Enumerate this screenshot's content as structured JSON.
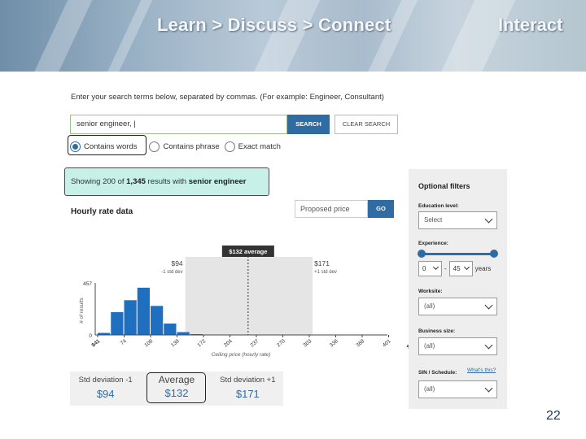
{
  "banner": {
    "title": "Learn > Discuss > Connect",
    "right": "Interact"
  },
  "search": {
    "instructions": "Enter your search terms below, separated by commas. (For example: Engineer, Consultant)",
    "value": "senior engineer, |",
    "search_label": "SEARCH",
    "clear_label": "CLEAR SEARCH",
    "options": [
      "Contains words",
      "Contains phrase",
      "Exact match"
    ],
    "selected_option": "Contains words"
  },
  "results": {
    "prefix": "Showing 200 of ",
    "count": "1,345",
    "middle": " results with ",
    "term": "senior engineer"
  },
  "hourly": {
    "title": "Hourly rate data"
  },
  "price": {
    "placeholder": "Proposed price",
    "go_label": "GO"
  },
  "chart_data": {
    "type": "bar",
    "ylabel": "# of results",
    "xlabel": "Ceiling price (hourly rate)",
    "ylim": [
      0,
      457
    ],
    "y_ticks": [
      "457",
      "0"
    ],
    "x_ticks": [
      "$41",
      "74",
      "106",
      "139",
      "172",
      "204",
      "237",
      "270",
      "303",
      "336",
      "368",
      "401",
      "$434"
    ],
    "bins": [
      41,
      57,
      74,
      90,
      106,
      123,
      139,
      155,
      172,
      188,
      204,
      221,
      237
    ],
    "values": [
      18,
      200,
      305,
      415,
      255,
      100,
      25,
      7,
      0,
      0,
      0,
      0,
      0
    ],
    "average": {
      "label": "$132 average",
      "value": 132
    },
    "std_low": {
      "value_label": "$94",
      "caption": "-1 std dev"
    },
    "std_high": {
      "value_label": "$171",
      "caption": "+1 std dev"
    },
    "bar_color": "#1f6fc1"
  },
  "stats": [
    {
      "label": "Std deviation -1",
      "value": "$94"
    },
    {
      "label": "Average",
      "value": "$132"
    },
    {
      "label": "Std deviation +1",
      "value": "$171"
    }
  ],
  "filters": {
    "title": "Optional filters",
    "education": {
      "label": "Education level:",
      "value": "Select"
    },
    "experience": {
      "label": "Experience:",
      "min": "0",
      "dash": "-",
      "max": "45",
      "unit": "years"
    },
    "worksite": {
      "label": "Worksite:",
      "value": "(all)"
    },
    "business": {
      "label": "Business size:",
      "value": "(all)"
    },
    "sin": {
      "label": "SIN / Schedule:",
      "link": "What's this?",
      "value": "(all)"
    }
  },
  "page_number": "22",
  "colors": {
    "accent": "#2f6ca3",
    "highlight": "#c6f0e8",
    "bar": "#1f6fc1"
  }
}
